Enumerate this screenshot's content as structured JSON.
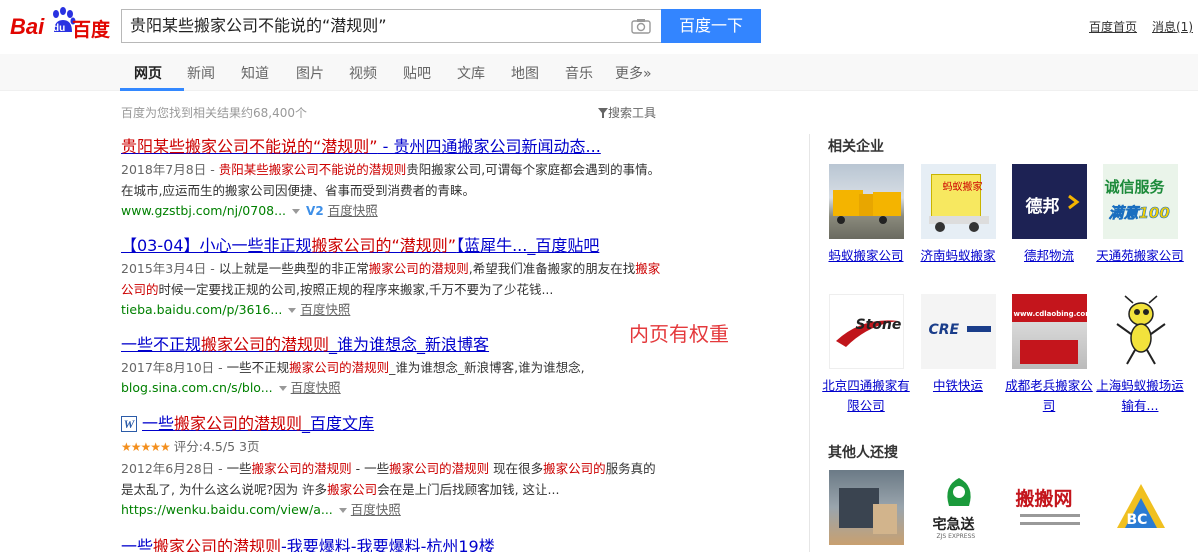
{
  "header": {
    "logo_bai": "Bai",
    "logo_du": "du",
    "logo_cn": "百度",
    "query": "贵阳某些搬家公司不能说的“潜规则”",
    "search_button": "百度一下",
    "home_link": "百度首页",
    "msg_link": "消息(1)"
  },
  "tabs": [
    "网页",
    "新闻",
    "知道",
    "图片",
    "视频",
    "贴吧",
    "文库",
    "地图",
    "音乐",
    "更多»"
  ],
  "stats": {
    "count": "百度为您找到相关结果约68,400个",
    "tools": "搜索工具"
  },
  "results": [
    {
      "title_a": "贵阳某些搬家公司不能说的“潜规则”",
      "title_b": " - 贵州四通搬家公司新闻动态...",
      "date": "2018年7月8日 - ",
      "abs_a": "贵阳某些搬家公司不能说的潜规则",
      "abs_b": "贵阳搬家公司,可谓每个家庭都会遇到的事情。在城市,应运而生的搬家公司因便捷、省事而受到消费者的青睐。",
      "url": "www.gzstbj.com/nj/0708...",
      "v2": "V2",
      "snap": "百度快照"
    },
    {
      "title_a": "【03-04】小心一些非正规",
      "title_em": "搬家公司的“潜规则”",
      "title_b": "【蓝犀牛..._百度贴吧",
      "date": "2015年3月4日 - ",
      "abs_a": "以上就是一些典型的非正常",
      "abs_em1": "搬家公司的潜规则",
      "abs_b": ",希望我们准备搬家的朋友在找",
      "abs_em2": "搬家公司的",
      "abs_c": "时候一定要找正规的公司,按照正规的程序来搬家,千万不要为了少花钱...",
      "url": "tieba.baidu.com/p/3616...",
      "snap": "百度快照"
    },
    {
      "title_a": "一些不正规",
      "title_em": "搬家公司的潜规则",
      "title_b": "_谁为谁想念_新浪博客",
      "date": "2017年8月10日 - ",
      "abs_a": "一些不正规",
      "abs_em1": "搬家公司的潜规则",
      "abs_b": "_谁为谁想念_新浪博客,谁为谁想念,",
      "url": "blog.sina.com.cn/s/blo...",
      "snap": "百度快照"
    },
    {
      "w_icon": "W",
      "title_a": "一些",
      "title_em": "搬家公司的潜规则",
      "title_b": "_百度文库",
      "stars": "★★★★★",
      "rating": "评分:4.5/5 3页",
      "date": "2012年6月28日 - ",
      "abs_a": "一些",
      "abs_em1": "搬家公司的潜规则",
      "abs_b": " - 一些",
      "abs_em2": "搬家公司的潜规则",
      "abs_c": " 现在很多",
      "abs_em3": "搬家公司的",
      "abs_d": "服务真的是太乱了, 为什么这么说呢?因为 许多",
      "abs_em4": "搬家公司",
      "abs_e": "会在是上门后找顾客加钱, 这让...",
      "url": "https://wenku.baidu.com/view/a...",
      "snap": "百度快照"
    },
    {
      "title_a": "一些",
      "title_em": "搬家公司的潜规则",
      "title_b": "-我要爆料-我要爆料-杭州19楼"
    }
  ],
  "annotation": "内页有权重",
  "sidebar": {
    "related_title": "相关企业",
    "others_title": "其他人还搜",
    "ents": [
      {
        "name": "蚂蚁搬家公司"
      },
      {
        "name": "济南蚂蚁搬家",
        "img_text": "蚂蚁搬家"
      },
      {
        "name": "德邦物流",
        "img_text": "德邦"
      },
      {
        "name": "天通苑搬家公司",
        "img_text1": "诚信服务",
        "img_text2": "满意100"
      },
      {
        "name": "北京四通搬家有限公司",
        "img_text": "Stone"
      },
      {
        "name": "中铁快运",
        "img_text": "CRE"
      },
      {
        "name": "成都老兵搬家公司",
        "img_text": "www.cdlaobing.com"
      },
      {
        "name": "上海蚂蚁搬场运输有..."
      }
    ],
    "others": [
      {
        "name": "others-1"
      },
      {
        "name": "宅急送",
        "img_text": "宅急送",
        "img_sub": "ZJS EXPRESS"
      },
      {
        "name": "搬搬网",
        "img_text": "搬搬网"
      },
      {
        "name": "BC",
        "img_text": "BC"
      }
    ]
  }
}
